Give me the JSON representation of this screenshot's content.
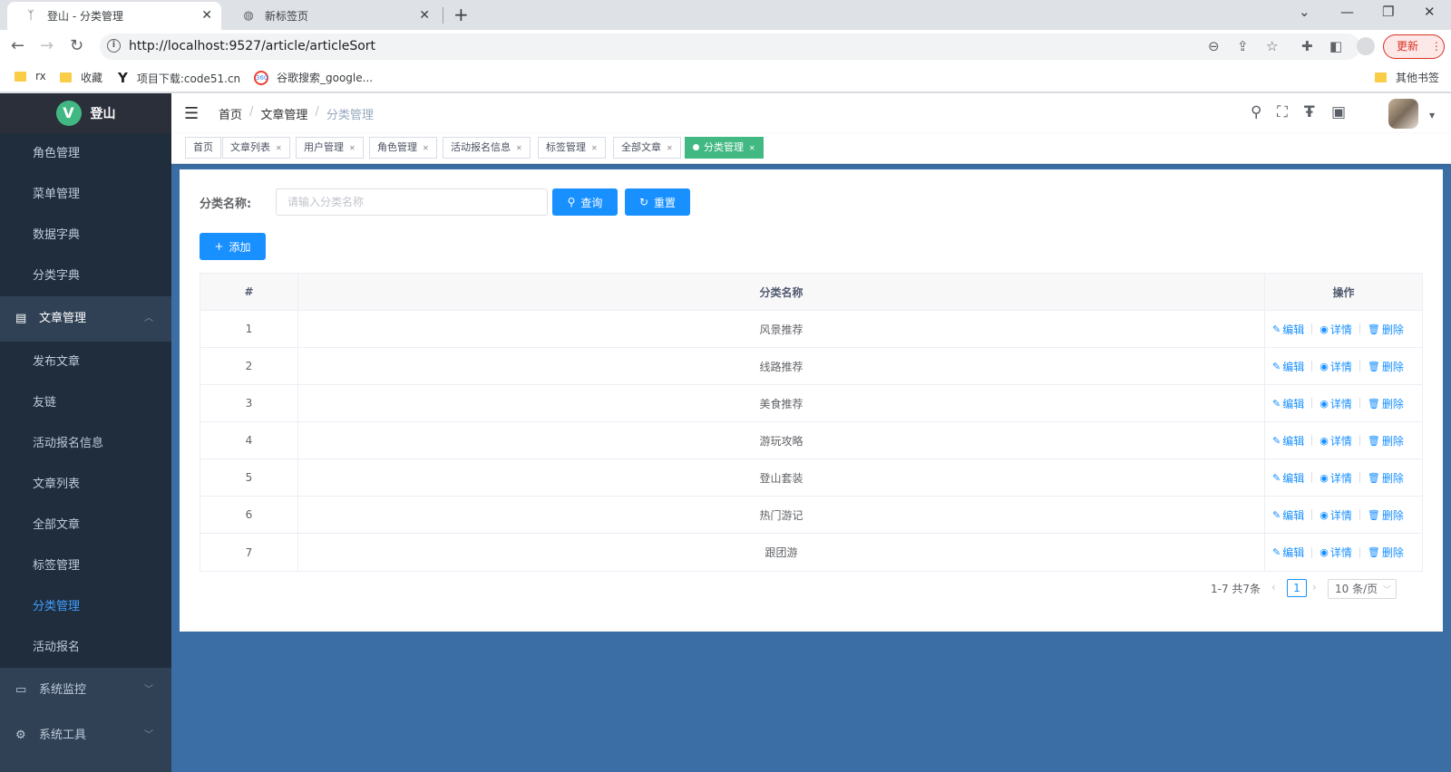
{
  "browser": {
    "tabs": [
      {
        "title": "登山 - 分类管理",
        "active": true
      },
      {
        "title": "新标签页",
        "active": false
      }
    ],
    "url": "http://localhost:9527/article/articleSort",
    "update_label": "更新",
    "bookmarks": [
      "rx",
      "收藏",
      "项目下载:code51.cn",
      "谷歌搜索_google...",
      "其他书签"
    ]
  },
  "sidebar": {
    "logo_title": "登山",
    "logo_letter": "V",
    "top_items": [
      "角色管理",
      "菜单管理",
      "数据字典",
      "分类字典"
    ],
    "open_group": "文章管理",
    "group_items": [
      "发布文章",
      "友链",
      "活动报名信息",
      "文章列表",
      "全部文章",
      "标签管理",
      "分类管理",
      "活动报名"
    ],
    "active_item": "分类管理",
    "bottom_groups": [
      "系统监控",
      "系统工具"
    ]
  },
  "header": {
    "breadcrumb": [
      "首页",
      "文章管理",
      "分类管理"
    ]
  },
  "tags": [
    "首页",
    "文章列表",
    "用户管理",
    "角色管理",
    "活动报名信息",
    "标签管理",
    "全部文章",
    "分类管理"
  ],
  "search": {
    "label": "分类名称:",
    "placeholder": "请输入分类名称",
    "value": "",
    "query_label": "查询",
    "reset_label": "重置",
    "add_label": "添加"
  },
  "table": {
    "columns": [
      "#",
      "分类名称",
      "操作"
    ],
    "rows": [
      {
        "idx": "1",
        "name": "风景推荐"
      },
      {
        "idx": "2",
        "name": "线路推荐"
      },
      {
        "idx": "3",
        "name": "美食推荐"
      },
      {
        "idx": "4",
        "name": "游玩攻略"
      },
      {
        "idx": "5",
        "name": "登山套装"
      },
      {
        "idx": "6",
        "name": "热门游记"
      },
      {
        "idx": "7",
        "name": "跟团游"
      }
    ],
    "actions": {
      "edit": "编辑",
      "detail": "详情",
      "delete": "删除"
    }
  },
  "pagination": {
    "total_text": "1-7 共7条",
    "current": "1",
    "page_size": "10 条/页"
  },
  "colors": {
    "primary": "#1890ff",
    "sidebar_bg": "#304156",
    "active_tag": "#42b983",
    "main_bg": "#3a6ea5"
  }
}
